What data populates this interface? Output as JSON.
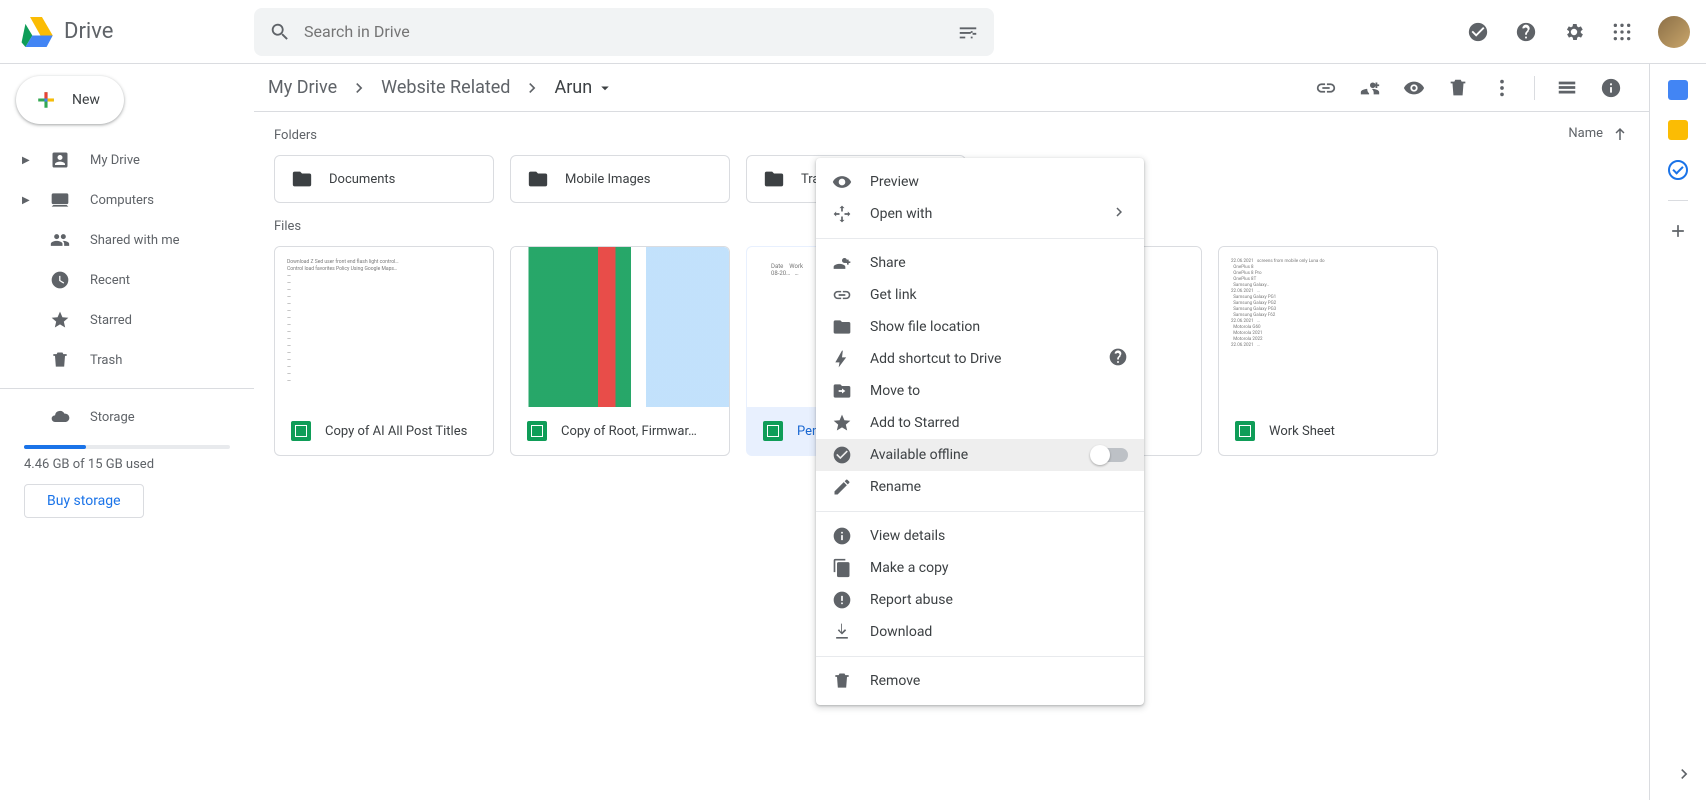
{
  "app": {
    "title": "Drive"
  },
  "search": {
    "placeholder": "Search in Drive"
  },
  "new_button": {
    "label": "New"
  },
  "nav": {
    "mydrive": "My Drive",
    "computers": "Computers",
    "shared": "Shared with me",
    "recent": "Recent",
    "starred": "Starred",
    "trash": "Trash",
    "storage": "Storage",
    "storage_used": "4.46 GB of 15 GB used",
    "buy": "Buy storage"
  },
  "breadcrumb": {
    "root": "My Drive",
    "mid": "Website Related",
    "current": "Arun"
  },
  "sort": {
    "label": "Name"
  },
  "sections": {
    "folders": "Folders",
    "files": "Files"
  },
  "folders": [
    {
      "name": "Documents"
    },
    {
      "name": "Mobile Images"
    },
    {
      "name": "Train"
    }
  ],
  "files": [
    {
      "name": "Copy of AI All Post Titles"
    },
    {
      "name": "Copy of Root, Firmwar…"
    },
    {
      "name": "Pend"
    },
    {
      "name": ""
    },
    {
      "name": "Work Sheet"
    }
  ],
  "ctx": {
    "preview": "Preview",
    "openwith": "Open with",
    "share": "Share",
    "getlink": "Get link",
    "showloc": "Show file location",
    "shortcut": "Add shortcut to Drive",
    "moveto": "Move to",
    "star": "Add to Starred",
    "offline": "Available offline",
    "rename": "Rename",
    "details": "View details",
    "copy": "Make a copy",
    "abuse": "Report abuse",
    "download": "Download",
    "remove": "Remove"
  }
}
